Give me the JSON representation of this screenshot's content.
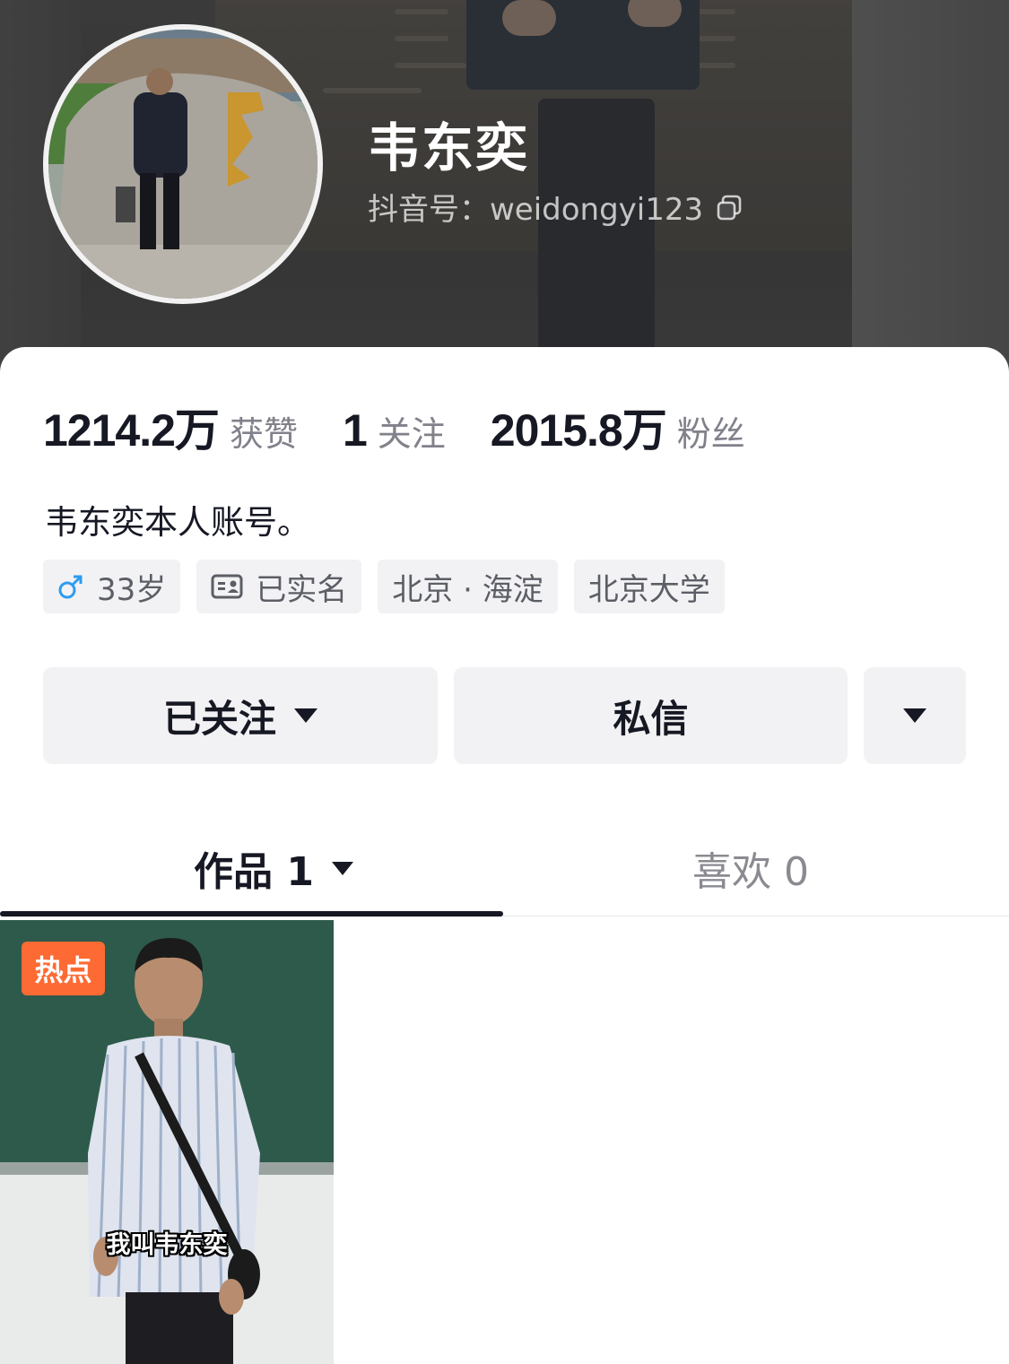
{
  "profile": {
    "nickname": "韦东奕",
    "douyin_id": "抖音号：weidongyi123",
    "bio": "韦东奕本人账号。"
  },
  "stats": [
    {
      "num": "1214.2万",
      "label": "获赞"
    },
    {
      "num": "1",
      "label": "关注"
    },
    {
      "num": "2015.8万",
      "label": "粉丝"
    }
  ],
  "tags": {
    "age": "33岁",
    "verified": "已实名",
    "location": "北京 · 海淀",
    "school": "北京大学"
  },
  "actions": {
    "follow": "已关注",
    "message": "私信"
  },
  "tabs": {
    "works": "作品 1",
    "likes": "喜欢 0"
  },
  "videos": [
    {
      "badge": "热点",
      "caption": "我叫韦东奕"
    }
  ],
  "colors": {
    "hot_badge": "#fe6a33",
    "gender_icon": "#2d9cf0",
    "text_primary": "#161823",
    "text_secondary": "#80818a"
  },
  "icons": [
    "copy-icon",
    "male-icon",
    "id-card-icon",
    "caret-down-icon"
  ]
}
